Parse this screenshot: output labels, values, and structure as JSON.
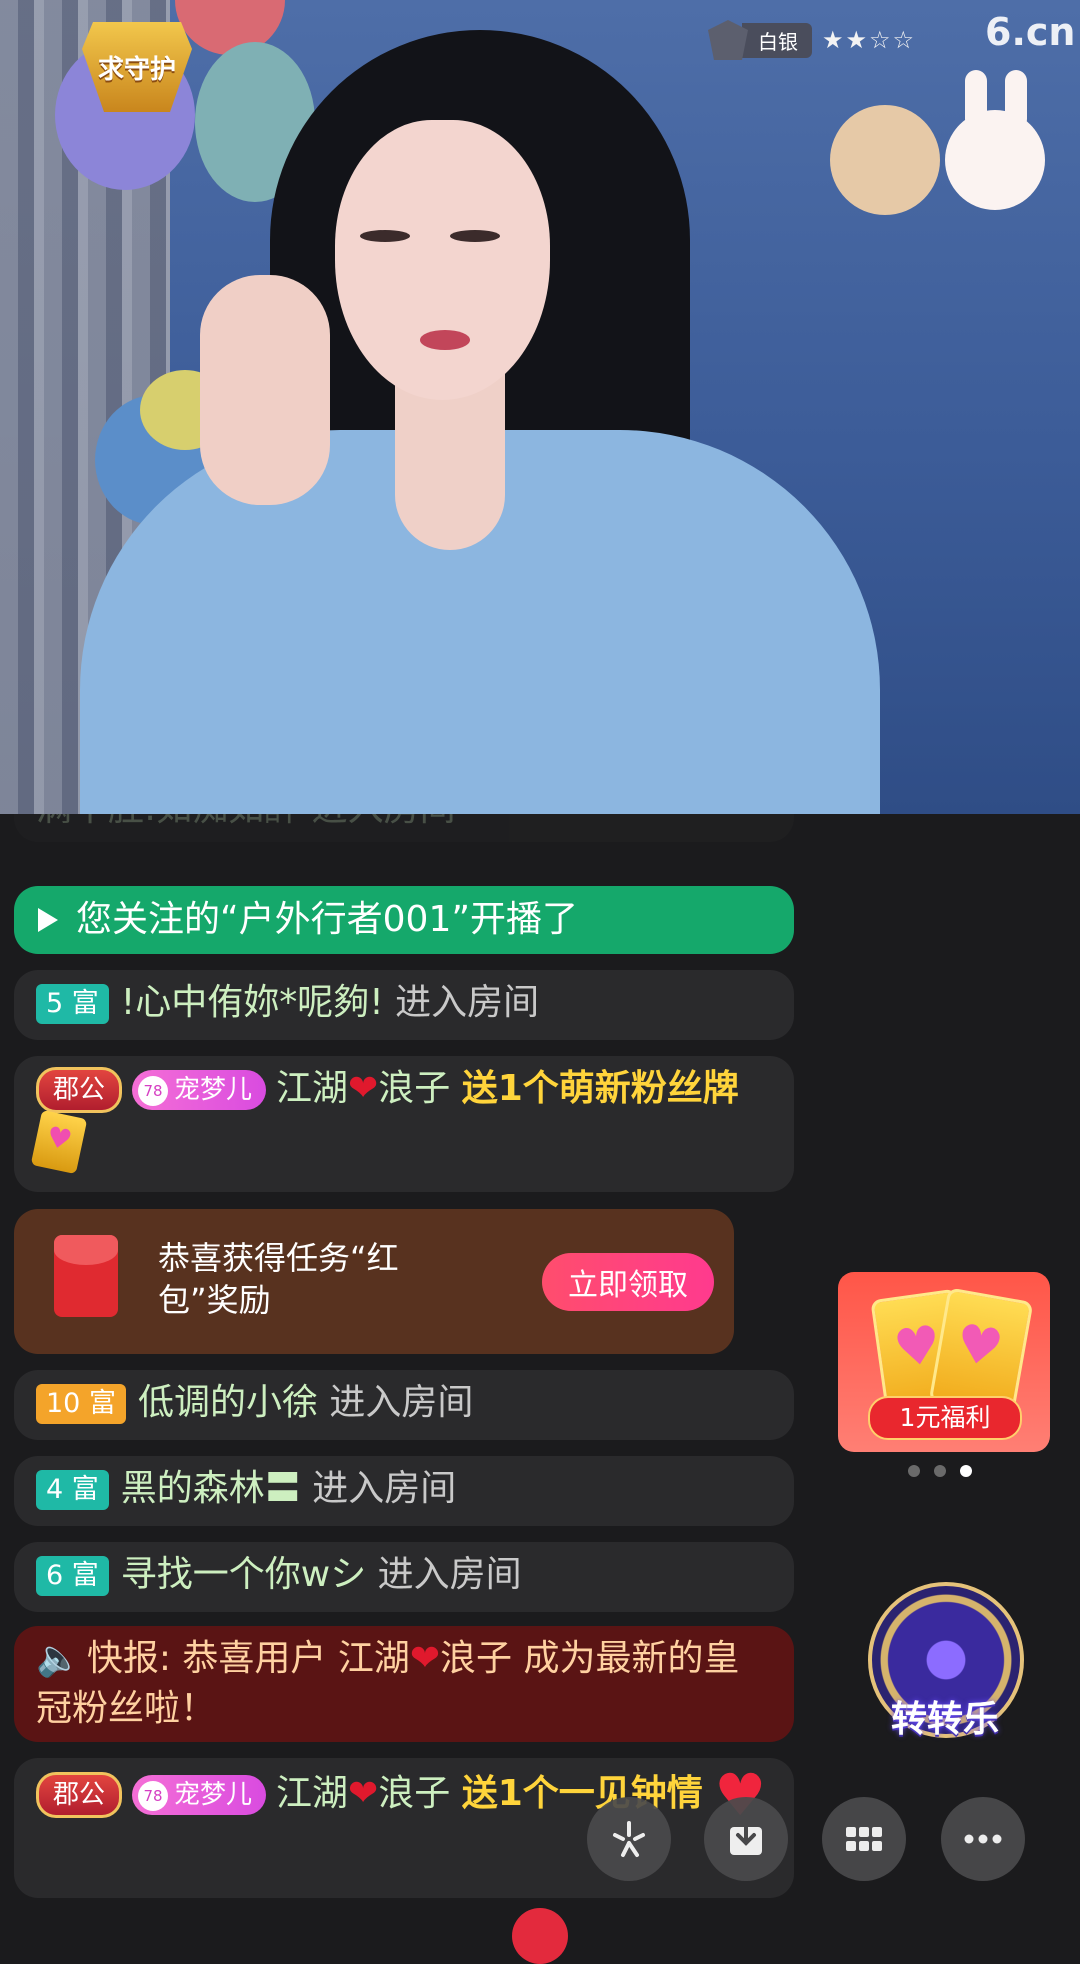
{
  "stream": {
    "guard_badge": "求守护",
    "rank_label": "白银",
    "rank_stars": "★★☆☆",
    "site_logo": "6.cn"
  },
  "chat": {
    "faded_text": "满十胜:如痴如醉 进入房间",
    "notice": "您关注的“户外行者001”开播了",
    "messages": [
      {
        "level": "5 富",
        "user": "!心中侑妳*呢夠!",
        "action": "进入房间"
      },
      {
        "level": "10 富",
        "user": "低调的小徐",
        "action": "进入房间"
      },
      {
        "level": "4 富",
        "user": "黑的森林〓",
        "action": "进入房间"
      },
      {
        "level": "6 富",
        "user": "寻找一个你wシ",
        "action": "进入房间"
      }
    ],
    "gift1": {
      "title_badge": "郡公",
      "fan_level": "78",
      "fan_badge": "宠梦儿",
      "user_a": "江湖",
      "user_b": "浪子",
      "gift_text": "送1个萌新粉丝牌"
    },
    "gift2": {
      "title_badge": "郡公",
      "fan_level": "78",
      "fan_badge": "宠梦儿",
      "user_a": "江湖",
      "user_b": "浪子",
      "gift_text": "送1个一见钟情"
    },
    "heart_symbol": "❤",
    "task": {
      "text": "恭喜获得任务“红包”奖励",
      "button": "立即领取"
    },
    "broadcast": {
      "prefix": "快报: 恭喜用户 江湖",
      "suffix": "浪子 成为最新的皇冠粉丝啦！"
    }
  },
  "widgets": {
    "promo_label": "1元福利",
    "carousel_dots": 3,
    "carousel_active": 3,
    "wheel_label": "转转乐"
  },
  "toolbar": {
    "buttons": [
      "sparkle-icon",
      "download-icon",
      "grid-icon",
      "more-icon"
    ]
  }
}
